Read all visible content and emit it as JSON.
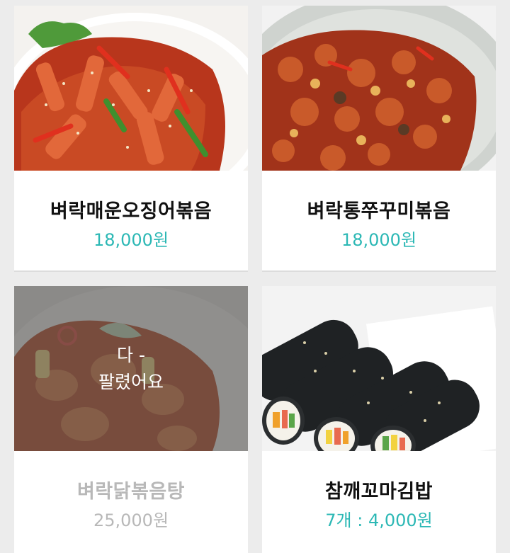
{
  "menu_items": [
    {
      "name": "벼락매운오징어볶음",
      "price": "18,000원",
      "image": "spicy-stir-fried-squid-photo",
      "sold_out": false
    },
    {
      "name": "벼락통쭈꾸미볶음",
      "price": "18,000원",
      "image": "stir-fried-baby-octopus-photo",
      "sold_out": false
    },
    {
      "name": "벼락닭볶음탕",
      "price": "25,000원",
      "image": "braised-spicy-chicken-photo",
      "sold_out": true
    },
    {
      "name": "참깨꼬마김밥",
      "price": "7개 : 4,000원",
      "image": "sesame-mini-gimbap-photo",
      "sold_out": false
    }
  ],
  "sold_out_overlay": {
    "line1": "다 -",
    "line2": "팔렸어요"
  },
  "colors": {
    "price": "#2cb8b5",
    "sold_out_text": "#b8b8b8",
    "background": "#ececec",
    "card": "#ffffff"
  }
}
